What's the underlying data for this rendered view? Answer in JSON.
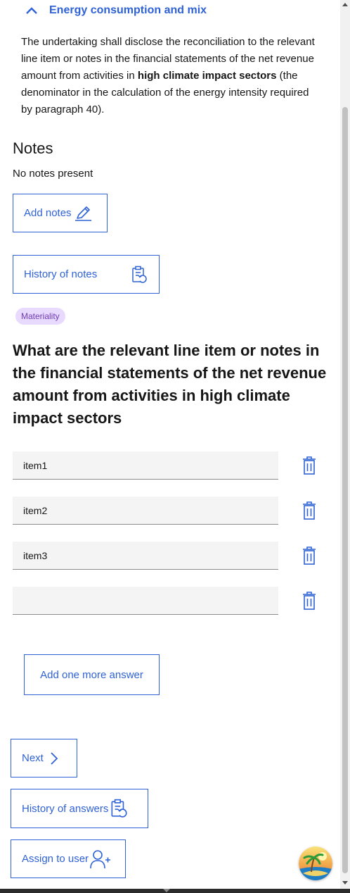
{
  "section": {
    "title": "Energy consumption and mix",
    "icon": "chevron-up-icon"
  },
  "description": {
    "part1": "The undertaking shall disclose the reconciliation to the relevant line item or notes in the financial statements of the net revenue amount from activities in ",
    "bold": "high climate impact sectors",
    "part2": " (the denominator in the calculation of the energy intensity required by paragraph 40)."
  },
  "notes": {
    "heading": "Notes",
    "empty_text": "No notes present",
    "add_label": "Add notes",
    "history_label": "History of notes"
  },
  "tag": "Materiality",
  "question": "What are the relevant line item or notes in the financial statements of the net revenue amount from activities in high climate impact sectors",
  "answers": [
    "item1",
    "item2",
    "item3",
    ""
  ],
  "buttons": {
    "add_answer": "Add one more answer",
    "next": "Next",
    "history_answers": "History of answers",
    "assign": "Assign to user"
  },
  "colors": {
    "accent": "#2f62d6",
    "tag_bg": "#e8daff",
    "tag_text": "#6f3bb5",
    "input_bg": "#f4f4f4"
  }
}
